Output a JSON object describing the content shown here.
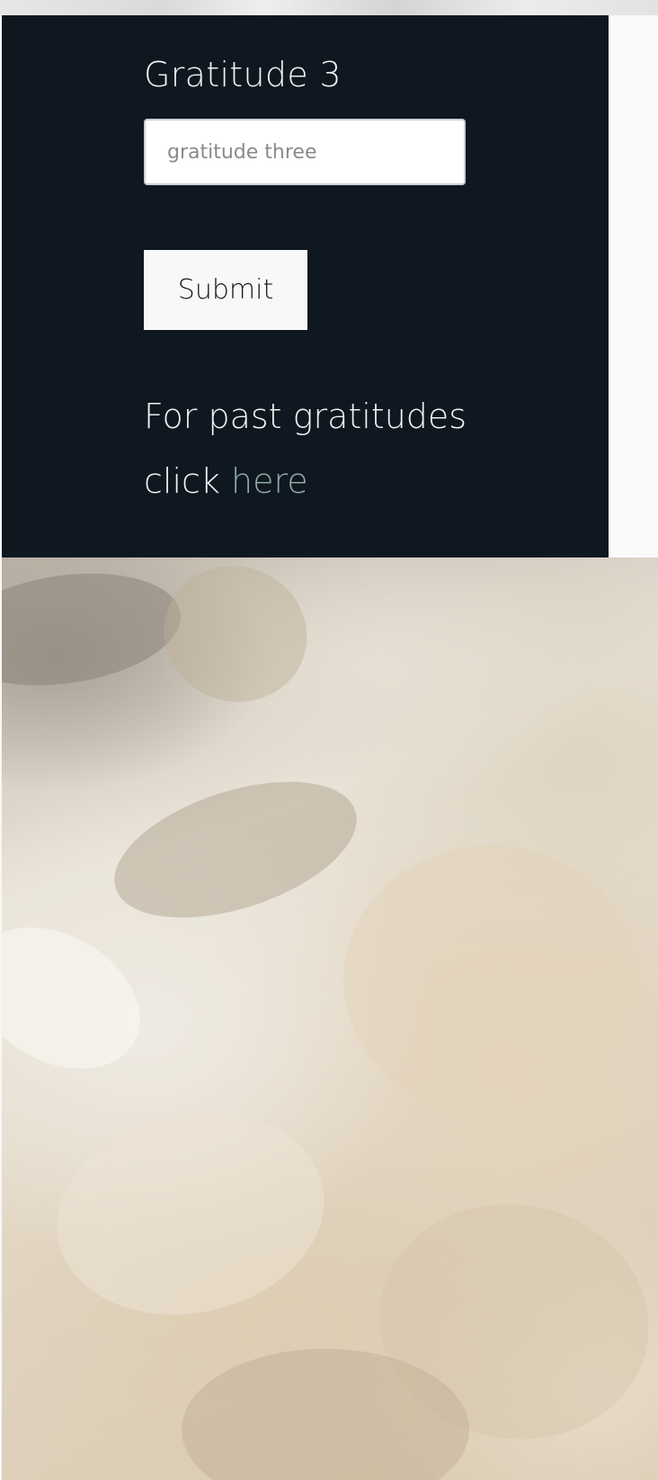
{
  "form": {
    "label": "Gratitude 3",
    "input_placeholder": "gratitude three",
    "input_value": "",
    "submit_label": "Submit"
  },
  "past": {
    "line1": "For past gratitudes",
    "line2_prefix": "click ",
    "link_label": "here"
  },
  "colors": {
    "panel_background": "#0f1720",
    "link": "#8eaaa6"
  }
}
